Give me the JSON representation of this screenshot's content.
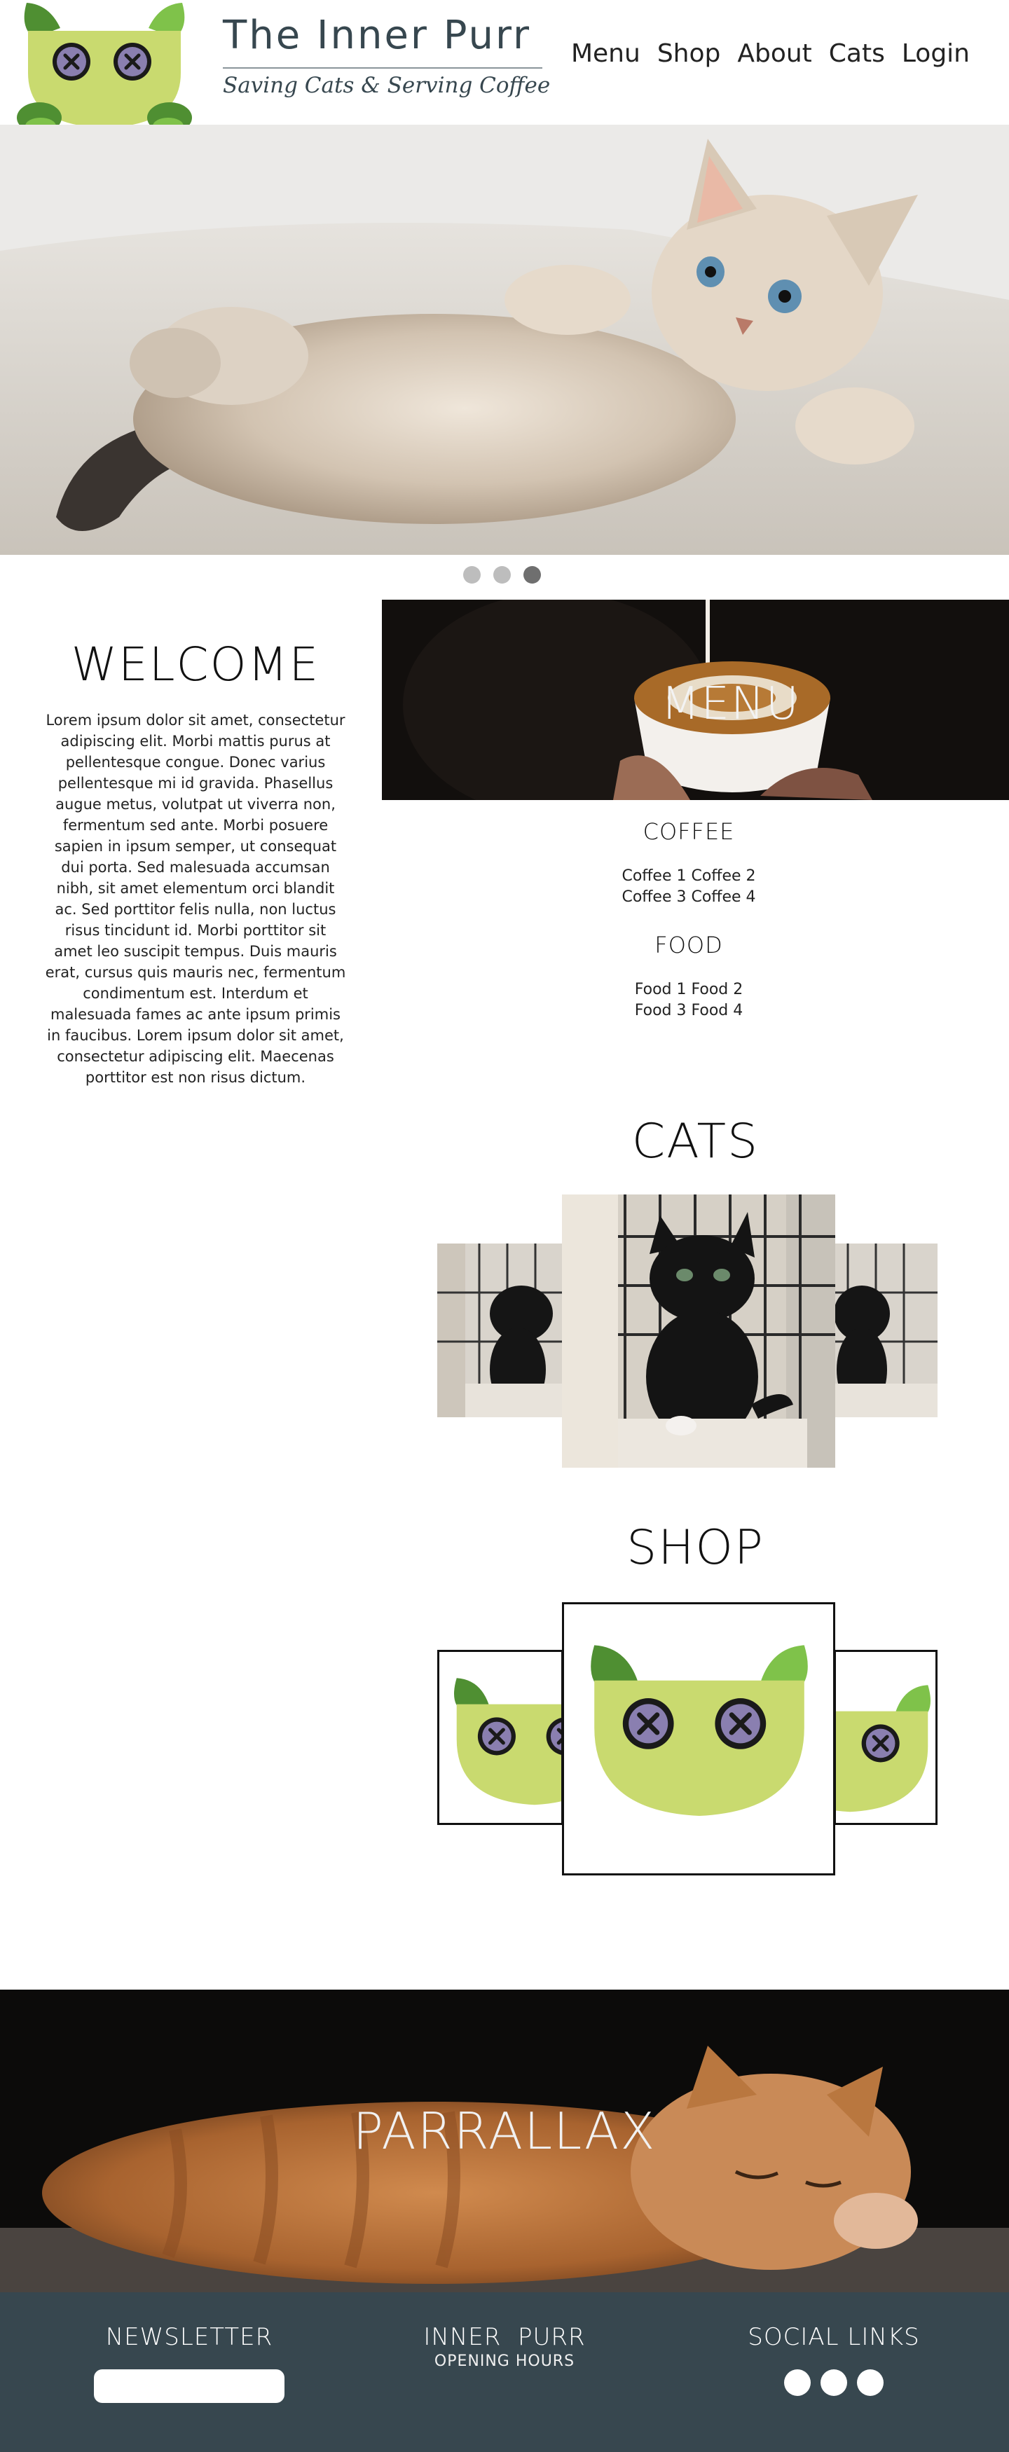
{
  "header": {
    "title": "The Inner Purr",
    "tagline": "Saving Cats & Serving Coffee",
    "logo_icon": "cat-face-logo"
  },
  "nav": [
    "Menu",
    "Shop",
    "About",
    "Cats",
    "Login"
  ],
  "hero": {
    "image": "kitten-lying-on-blanket",
    "slides": 3,
    "active_slide": 3
  },
  "welcome": {
    "title": "WELCOME",
    "body": "Lorem ipsum dolor sit amet, consectetur adipiscing elit. Morbi mattis purus at pellentesque congue. Donec varius pellentesque mi id gravida. Phasellus augue metus, volutpat ut viverra non, fermentum sed ante. Morbi posuere sapien in ipsum semper, ut consequat dui porta. Sed malesuada accumsan nibh, sit amet elementum orci blandit ac. Sed porttitor felis nulla, non luctus risus tincidunt id. Morbi porttitor sit amet leo suscipit tempus. Duis mauris erat, cursus quis mauris nec, fermentum condimentum est. Interdum et malesuada fames ac ante ipsum primis in faucibus. Lorem ipsum dolor sit amet, consectetur adipiscing elit. Maecenas porttitor est non risus dictum."
  },
  "menu": {
    "banner_label": "MENU",
    "banner_image": "latte-art-cup",
    "coffee_title": "COFFEE",
    "coffee_lines": [
      "Coffee 1 Coffee 2",
      "Coffee 3 Coffee 4"
    ],
    "food_title": "FOOD",
    "food_lines": [
      "Food 1 Food 2",
      "Food 3 Food 4"
    ]
  },
  "cats": {
    "title": "CATS",
    "image": "black-kitten-in-cage"
  },
  "shop": {
    "title": "SHOP",
    "image": "cat-face-logo"
  },
  "parallax": {
    "label": "PARRALLAX",
    "image": "sleeping-orange-kitten"
  },
  "footer": {
    "newsletter_title": "NEWSLETTER",
    "brand_title": "INNER  PURR",
    "brand_sub": "OPENING HOURS",
    "social_title": "SOCIAL LINKS",
    "social_icons": [
      "social-link-icon",
      "social-link-icon",
      "social-link-icon"
    ]
  },
  "colors": {
    "slate": "#37474f",
    "logo_lime": "#c9da6f",
    "logo_green_dark": "#4f8f32",
    "logo_green_light": "#7fc24a",
    "button_purple": "#8a7fb0",
    "dot_active": "#6f6f6f",
    "dot_inactive": "#bdbdbd"
  }
}
